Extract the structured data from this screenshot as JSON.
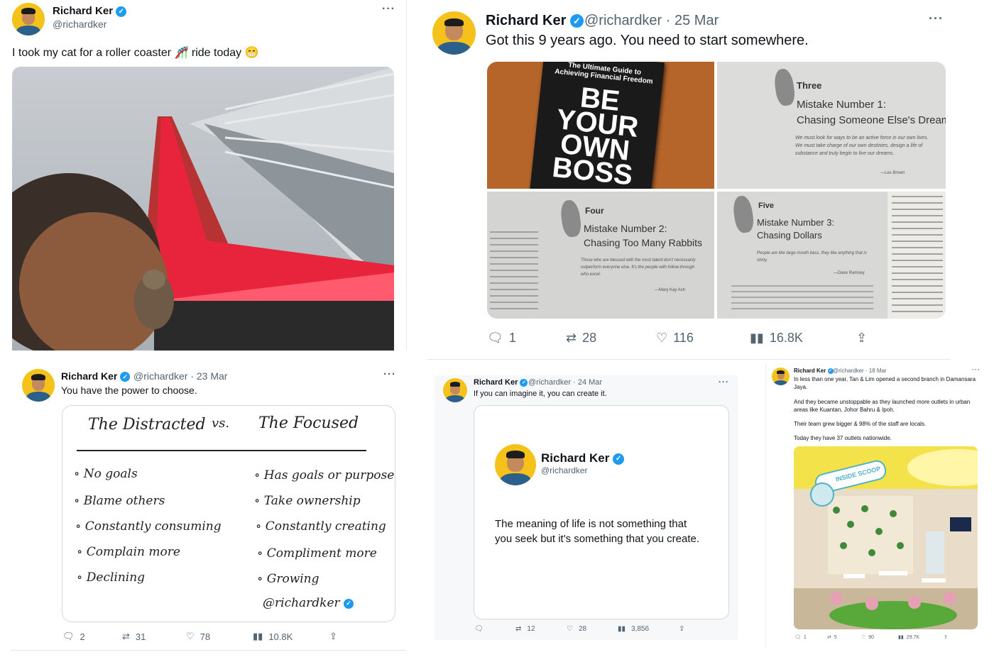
{
  "tweet1": {
    "name": "Richard Ker",
    "handle": "@richardker",
    "text": "I took my cat for a roller coaster 🎢 ride today 😁"
  },
  "tweet2": {
    "name": "Richard Ker",
    "meta": "@richardker · 25 Mar",
    "text": "Got this 9 years ago. You need to start somewhere.",
    "book": {
      "subtitle": "The Ultimate Guide to Achieving Financial Freedom",
      "title_lines": [
        "BE",
        "YOUR",
        "OWN",
        "BOSS"
      ]
    },
    "page_three": {
      "label": "Three",
      "heading_1": "Mistake Number 1:",
      "heading_2": "Chasing Someone Else's Dream",
      "quote": "We must look for ways to be an active force in our own lives. We must take charge of our own destinies, design a life of substance and truly begin to live our dreams.",
      "author": "—Les Brown"
    },
    "page_four": {
      "label": "Four",
      "heading_1": "Mistake Number 2:",
      "heading_2": "Chasing Too Many Rabbits",
      "quote": "Those who are blessed with the most talent don't necessarily outperform everyone else. It's the people with follow-through who excel.",
      "author": "—Mary Kay Ash"
    },
    "page_five": {
      "label": "Five",
      "heading_1": "Mistake Number 3:",
      "heading_2": "Chasing Dollars",
      "quote": "People are like large mouth bass, they like anything that is shiny.",
      "author": "—Dave Ramsey"
    },
    "stats": {
      "replies": "1",
      "retweets": "28",
      "likes": "116",
      "views": "16.8K"
    }
  },
  "tweet3": {
    "name": "Richard Ker",
    "meta": "@richardker · 23 Mar",
    "text": "You have the power to choose.",
    "sketch": {
      "left_title": "The Distracted",
      "vs": "vs.",
      "right_title": "The Focused",
      "left_items": [
        "No goals",
        "Blame others",
        "Constantly consuming",
        "Complain more",
        "Declining"
      ],
      "right_items": [
        "Has goals or purpose",
        "Take ownership",
        "Constantly creating",
        "Compliment more",
        "Growing"
      ],
      "signature": "@richardker"
    },
    "stats": {
      "replies": "2",
      "retweets": "31",
      "likes": "78",
      "views": "10.8K"
    }
  },
  "tweet4": {
    "name": "Richard Ker",
    "meta": "@richardker · 24 Mar",
    "text": "If you can imagine it, you can create it.",
    "quote_card": {
      "name": "Richard Ker",
      "handle": "@richardker",
      "quote_line_1": "The meaning of life is not something that",
      "quote_line_2": "you seek but it's something that you create."
    },
    "stats": {
      "replies": "",
      "retweets": "12",
      "likes": "28",
      "views": "3,856"
    }
  },
  "tweet5": {
    "name": "Richard Ker",
    "meta": "@richardker · 18 Mar",
    "paragraphs": [
      "In less than one year, Tan & Lim opened a second branch in Damansara",
      "Jaya.",
      "And they became unstoppable as they launched more outlets in urban",
      "areas like Kuantan, Johor Bahru & Ipoh.",
      "Their team grew bigger & 98% of the staff are locals.",
      "Today they have 37 outlets nationwide."
    ],
    "store_sign": "INSIDE SCOOP",
    "stats": {
      "replies": "1",
      "retweets": "5",
      "likes": "90",
      "views": "29.7K"
    }
  },
  "colors": {
    "accent": "#1d9bf0",
    "avatar_bg": "#f4c21a",
    "coaster_red": "#e8243c",
    "store_yellow": "#f3e24a"
  }
}
